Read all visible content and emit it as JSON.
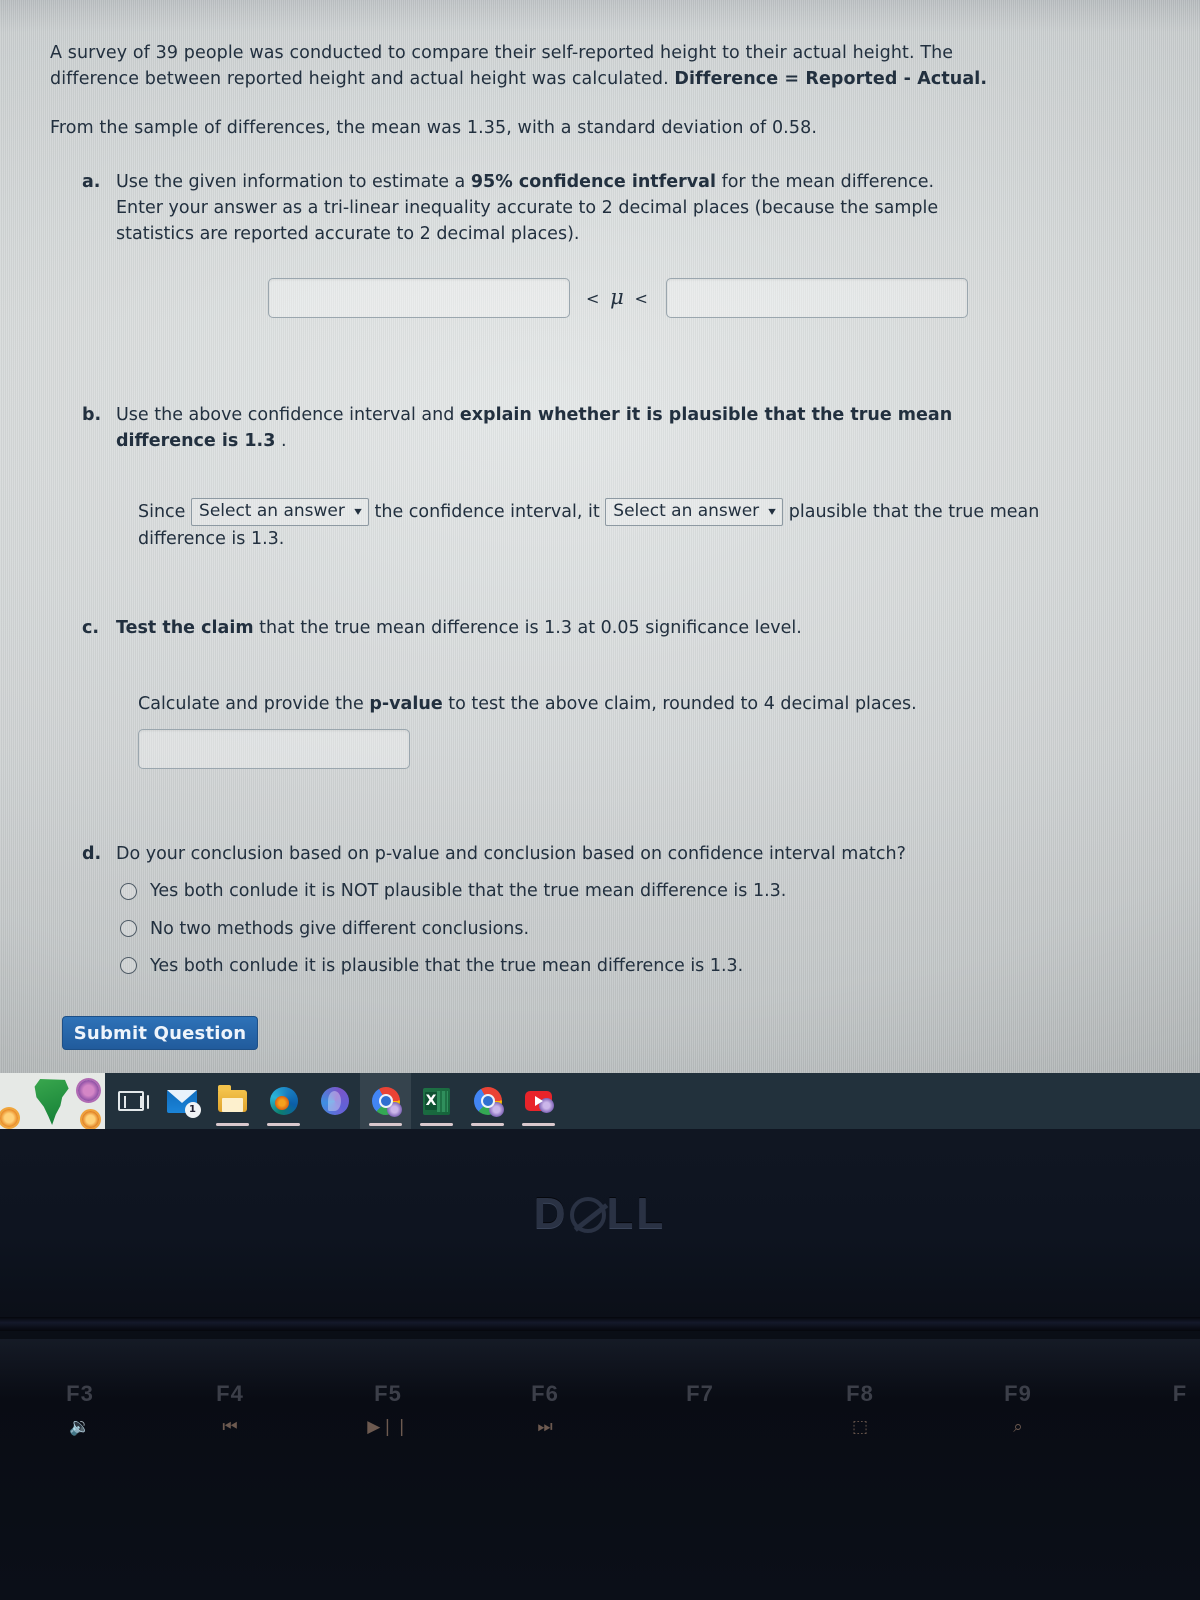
{
  "question": {
    "intro_line1": "A survey of 39 people was conducted to compare their self-reported height to their actual height. The",
    "intro_line2_pre": "difference between reported height and actual height was calculated. ",
    "intro_line2_bold": "Difference = Reported - Actual.",
    "sample_stats": "From the sample of differences, the mean was 1.35, with a standard deviation of 0.58.",
    "parts": {
      "a": {
        "marker": "a.",
        "text_pre": "Use the given information to estimate a ",
        "text_bold": "95% confidence intferval",
        "text_post": " for the mean difference.",
        "text_line2": "Enter your answer as a tri-linear inequality accurate to 2 decimal places (because the sample",
        "text_line3": "statistics are reported accurate to 2 decimal places).",
        "lower_bound_value": "",
        "upper_bound_value": "",
        "inequality_left": "<",
        "inequality_mu": "μ",
        "inequality_right": "<"
      },
      "b": {
        "marker": "b.",
        "text_pre": "Use the above confidence interval and ",
        "text_bold": "explain whether it is plausible that the true mean",
        "text_bold2": "difference is 1.3",
        "text_post": " .",
        "sentence_since": "Since",
        "dropdown1_value": "Select an answer",
        "sentence_mid": "the confidence interval, it",
        "dropdown2_value": "Select an answer",
        "sentence_end": "plausible that the true mean",
        "sentence_end2": "difference is 1.3."
      },
      "c": {
        "marker": "c.",
        "text_bold": "Test the claim",
        "text_post": " that the true mean difference is 1.3 at 0.05 significance level.",
        "pvalue_prompt_pre": "Calculate and provide the ",
        "pvalue_prompt_bold": "p-value",
        "pvalue_prompt_post": " to test the above claim, rounded to 4 decimal places.",
        "pvalue_value": ""
      },
      "d": {
        "marker": "d.",
        "text": "Do your conclusion based on p-value and conclusion based on confidence interval match?",
        "options": [
          "Yes both conlude it is NOT plausible that the true mean difference is 1.3.",
          "No two methods give different conclusions.",
          "Yes both conlude it is plausible that the true mean difference is 1.3."
        ]
      }
    },
    "submit_label": "Submit Question"
  },
  "taskbar": {
    "items": [
      {
        "name": "task-view",
        "badge": "",
        "running": false
      },
      {
        "name": "mail",
        "badge": "1",
        "running": false
      },
      {
        "name": "file-explorer",
        "badge": "",
        "running": true
      },
      {
        "name": "edge",
        "badge": "",
        "running": true
      },
      {
        "name": "copilot",
        "badge": "",
        "running": false
      },
      {
        "name": "chrome-active",
        "badge": "",
        "running": true
      },
      {
        "name": "excel",
        "badge": "",
        "running": true
      },
      {
        "name": "chrome",
        "badge": "",
        "running": true
      },
      {
        "name": "youtube",
        "badge": "",
        "running": true
      }
    ]
  },
  "laptop": {
    "brand": "DELL",
    "brand_prefix": "D",
    "brand_suffix": "LL",
    "function_keys": [
      {
        "label": "F3",
        "glyph": "🔉"
      },
      {
        "label": "F4",
        "glyph": "⏮"
      },
      {
        "label": "F5",
        "glyph": "▶❘❘"
      },
      {
        "label": "F6",
        "glyph": "⏭"
      },
      {
        "label": "F7",
        "glyph": ""
      },
      {
        "label": "F8",
        "glyph": "⬚"
      },
      {
        "label": "F9",
        "glyph": "⌕"
      },
      {
        "label": "F",
        "glyph": ""
      }
    ]
  },
  "colors": {
    "screen_bg": "#dfe3e3",
    "text": "#22303f",
    "submit_blue": "#2e72b8",
    "taskbar": "#22313c",
    "bezel": "#0b0f18"
  }
}
